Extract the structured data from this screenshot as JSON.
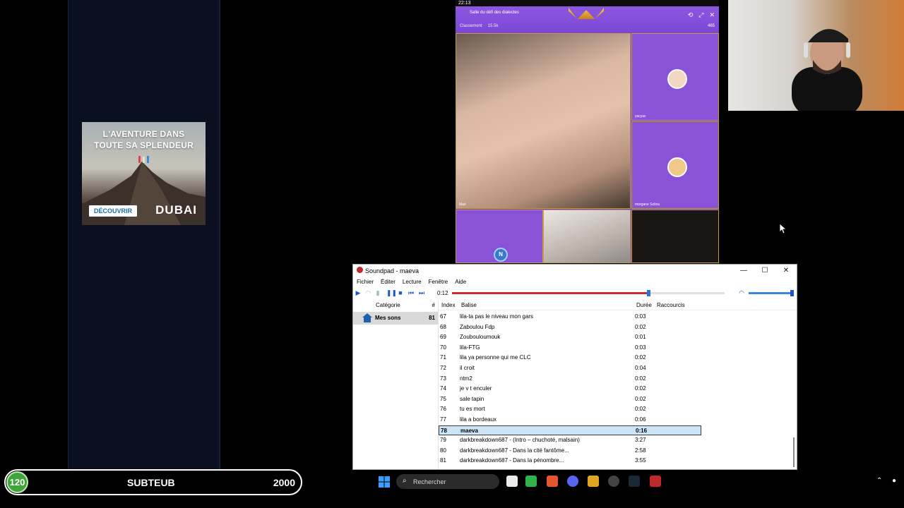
{
  "ad": {
    "headline_line1": "L'AVENTURE DANS",
    "headline_line2": "TOUTE SA SPLENDEUR",
    "cta": "DÉCOUVRIR",
    "brand": "DUBAI"
  },
  "call": {
    "clock": "22:13",
    "room_title": "Salle du défi des dialectes",
    "ranking_label": "Classement",
    "views": "15.5k",
    "viewer_count": "465",
    "tile_a_name": "yacyac",
    "tile_b_name": "morgane Solina",
    "main_tile_name": "Maé"
  },
  "soundpad": {
    "title": "Soundpad - maeva",
    "menu": [
      "Fichier",
      "Éditer",
      "Lecture",
      "Fenêtre",
      "Aide"
    ],
    "time": "0:12",
    "seek_fraction": 0.72,
    "volume_fraction": 0.95,
    "categories_header": {
      "name": "Catégorie",
      "count": "#"
    },
    "category": {
      "name": "Mes sons",
      "count": "81"
    },
    "columns": {
      "index": "Index",
      "tag": "Balise",
      "duration": "Durée",
      "shortcuts": "Raccourcis"
    },
    "rows": [
      {
        "index": "67",
        "tag": "lila-ta pas le niveau mon gars",
        "duration": "0:03"
      },
      {
        "index": "68",
        "tag": "Zaboulou Fdp",
        "duration": "0:02"
      },
      {
        "index": "69",
        "tag": "Zoubouloumouk",
        "duration": "0:01"
      },
      {
        "index": "70",
        "tag": "lila-FTG",
        "duration": "0:03"
      },
      {
        "index": "71",
        "tag": "lila ya personne qui me CLC",
        "duration": "0:02"
      },
      {
        "index": "72",
        "tag": "il croit",
        "duration": "0:04"
      },
      {
        "index": "73",
        "tag": "ntm2",
        "duration": "0:02"
      },
      {
        "index": "74",
        "tag": "je v t enculer",
        "duration": "0:02"
      },
      {
        "index": "75",
        "tag": "sale tapin",
        "duration": "0:02"
      },
      {
        "index": "76",
        "tag": "tu es mort",
        "duration": "0:02"
      },
      {
        "index": "77",
        "tag": "lila a bordeaux",
        "duration": "0:06"
      },
      {
        "index": "78",
        "tag": "maeva",
        "duration": "0:16"
      },
      {
        "index": "79",
        "tag": "darkbreakdown687 - (Intro – chuchoté, malsain)",
        "duration": "3:27"
      },
      {
        "index": "80",
        "tag": "darkbreakdown687 - Dans la cité fantôme...",
        "duration": "2:58"
      },
      {
        "index": "81",
        "tag": "darkbreakdown687 - Dans la pénombre...",
        "duration": "3:55"
      }
    ]
  },
  "overlay": {
    "level": "120",
    "name": "SUBTEUB",
    "value": "2000"
  },
  "taskbar": {
    "search_placeholder": "Rechercher"
  }
}
